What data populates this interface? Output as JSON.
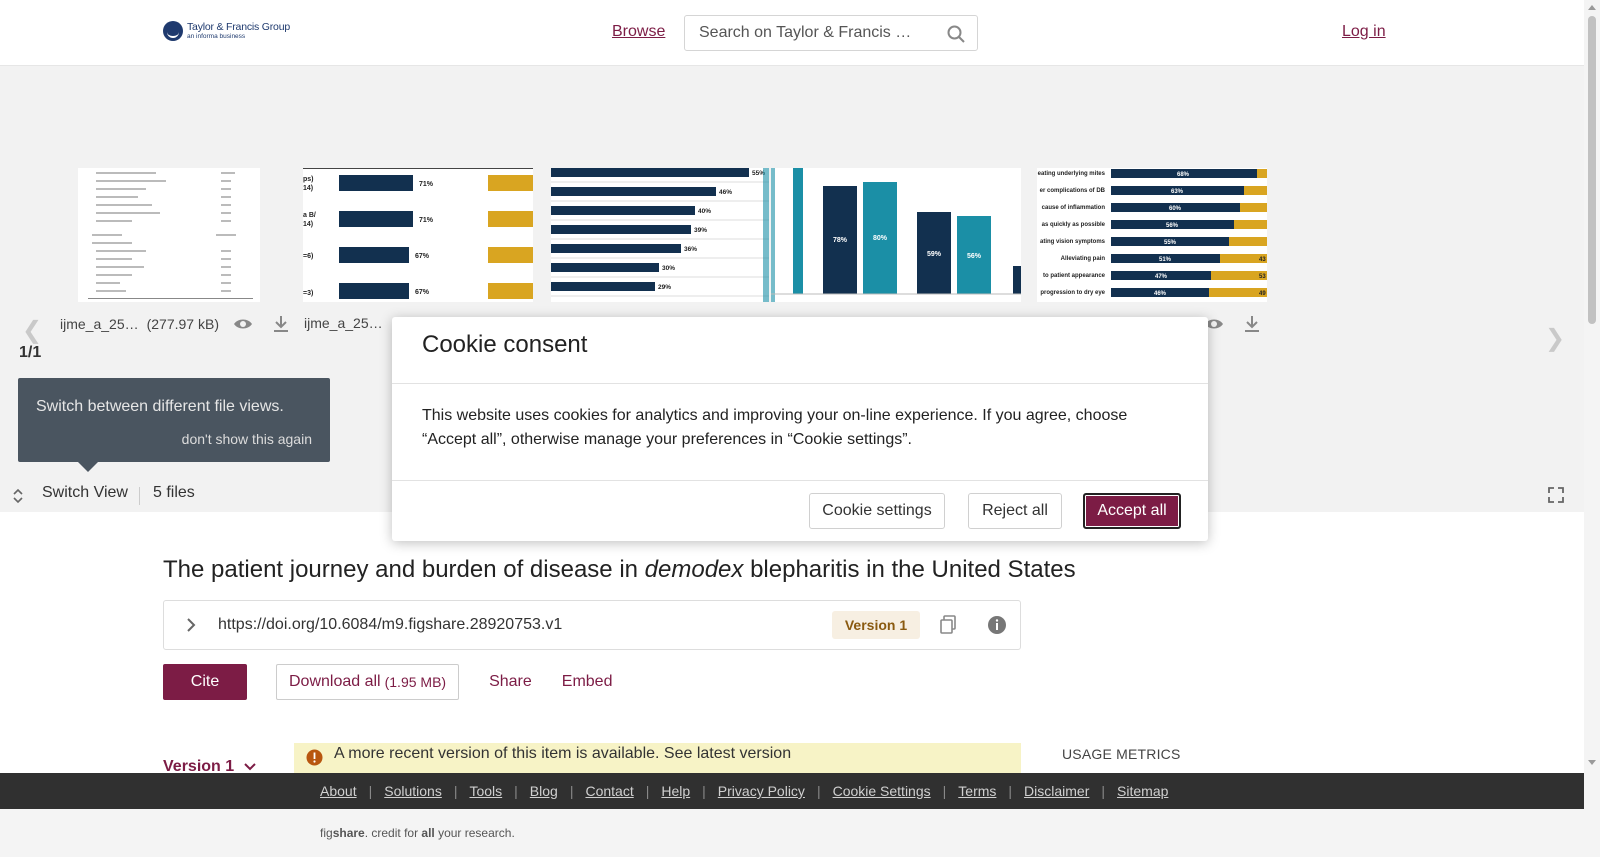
{
  "header": {
    "logo_name": "Taylor & Francis Group",
    "logo_sub": "an informa business",
    "browse": "Browse",
    "search_placeholder": "Search on Taylor & Francis …",
    "login": "Log in"
  },
  "viewer": {
    "counter": "1/1",
    "files": [
      {
        "name": "ijme_a_25…",
        "size": "(277.97 kB)"
      },
      {
        "name": "ijme_a_250…",
        "size": ""
      }
    ],
    "tooltip_text": "Switch between different file views.",
    "tooltip_dismiss": "don't show this again",
    "switch_view": "Switch View",
    "files_count": "5 files",
    "thumb2": {
      "values": [
        "71%",
        "71%",
        "67%",
        "67%"
      ],
      "labels": [
        "ps)",
        "14)",
        "a B/",
        "14)",
        "=6)",
        "=3)"
      ]
    },
    "thumb3": {
      "values": [
        "55%",
        "46%",
        "40%",
        "39%",
        "36%",
        "30%",
        "29%"
      ]
    },
    "thumb4": {
      "values": [
        "78%",
        "80%",
        "59%",
        "56%"
      ]
    },
    "thumb5": {
      "labels": [
        "eating underlying mites",
        "er complications of DB",
        "cause of inflammation",
        "as quickly as possible",
        "ating vision symptoms",
        "Alleviating pain",
        "to patient appearance",
        "progression to dry eye"
      ],
      "values": [
        "68%",
        "63%",
        "60%",
        "56%",
        "55%",
        "51%",
        "47%",
        "46%"
      ],
      "tail": [
        "",
        "",
        "",
        "",
        "",
        "43",
        "53",
        "49"
      ]
    }
  },
  "article": {
    "title_pre": "The patient journey and burden of disease in ",
    "title_em": "demodex",
    "title_post": " blepharitis in the United States",
    "doi": "https://doi.org/10.6084/m9.figshare.28920753.v1",
    "version_badge": "Version 1",
    "cite": "Cite",
    "download_all": "Download all",
    "download_size": "(1.95 MB)",
    "share": "Share",
    "embed": "Embed",
    "version_select": "Version 1",
    "notice": "A more recent version of this item is available. See latest version",
    "usage_metrics": "USAGE METRICS"
  },
  "footer": {
    "links": [
      "About",
      "Solutions",
      "Tools",
      "Blog",
      "Contact",
      "Help",
      "Privacy Policy",
      "Cookie Settings",
      "Terms",
      "Disclaimer",
      "Sitemap"
    ],
    "credit_pre": "fig",
    "credit_brand": "share",
    "credit_mid": ". credit for ",
    "credit_all": "all",
    "credit_post": " your research."
  },
  "cookie_modal": {
    "title": "Cookie consent",
    "body": "This website uses cookies for analytics and improving your on-line experience. If you agree, choose “Accept all”, otherwise manage your preferences in “Cookie settings”.",
    "settings_button": "Cookie settings",
    "reject_button": "Reject all",
    "accept_button": "Accept all"
  },
  "colors": {
    "brand": "#7c1c45",
    "navy": "#12304f",
    "teal": "#1b8fa6",
    "gold": "#d9a521",
    "footer_bg": "#303030"
  }
}
